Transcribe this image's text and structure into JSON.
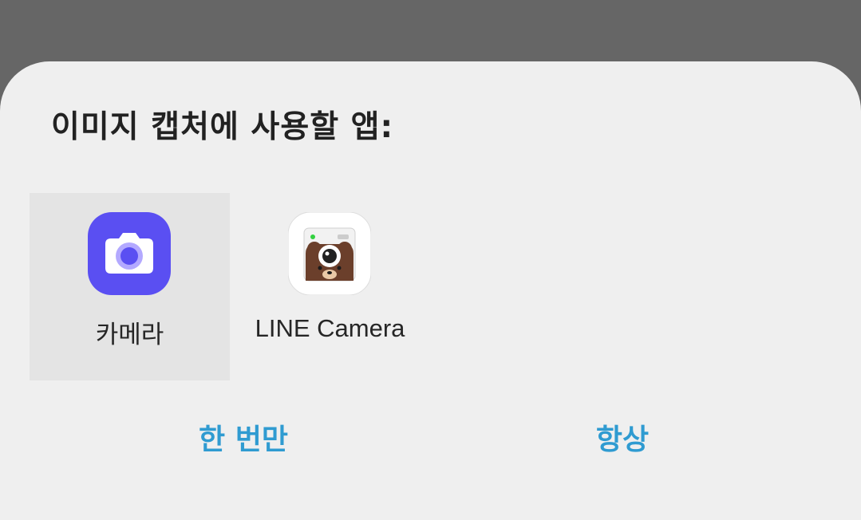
{
  "dialog": {
    "title": "이미지 캡처에 사용할 앱:"
  },
  "apps": [
    {
      "label": "카메라",
      "icon": "samsung-camera-icon",
      "selected": true,
      "accent": "#5a4ff2"
    },
    {
      "label": "LINE Camera",
      "icon": "line-camera-icon",
      "selected": false,
      "accent": "#6b3f2b"
    }
  ],
  "actions": {
    "once_label": "한 번만",
    "always_label": "항상",
    "color": "#2f9bd1"
  }
}
